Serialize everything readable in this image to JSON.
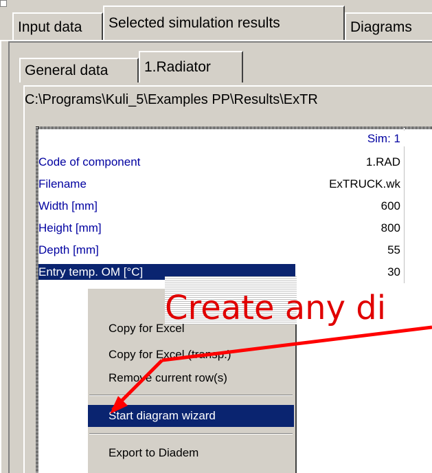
{
  "tabs": [
    {
      "label": "Input data"
    },
    {
      "label": "Selected simulation results"
    },
    {
      "label": "Diagrams"
    }
  ],
  "subtabs": [
    {
      "label": "General data"
    },
    {
      "label": "1.Radiator"
    }
  ],
  "path": "C:\\Programs\\Kuli_5\\Examples PP\\Results\\ExTR",
  "grid": {
    "column_header": "Sim: 1",
    "rows": [
      {
        "key": "Code of component",
        "value": "1.RAD"
      },
      {
        "key": "Filename",
        "value": "ExTRUCK.wk"
      },
      {
        "key": "Width [mm]",
        "value": "600"
      },
      {
        "key": "Height [mm]",
        "value": "800"
      },
      {
        "key": "Depth [mm]",
        "value": "55"
      },
      {
        "key": "Entry temp. OM  [°C]",
        "value": "30"
      }
    ]
  },
  "context_menu": {
    "items": [
      {
        "label": "Copy for Excel"
      },
      {
        "label": "Copy for Excel (transp.)"
      },
      {
        "label": "Remove current row(s)"
      },
      {
        "label": "Start diagram wizard"
      },
      {
        "label": "Export to Diadem"
      }
    ]
  },
  "callout": {
    "text": "Create any di",
    "color": "#e00000"
  },
  "colors": {
    "selection": "#0a2470",
    "key_text": "#0000a0",
    "window": "#d4d0c8"
  }
}
